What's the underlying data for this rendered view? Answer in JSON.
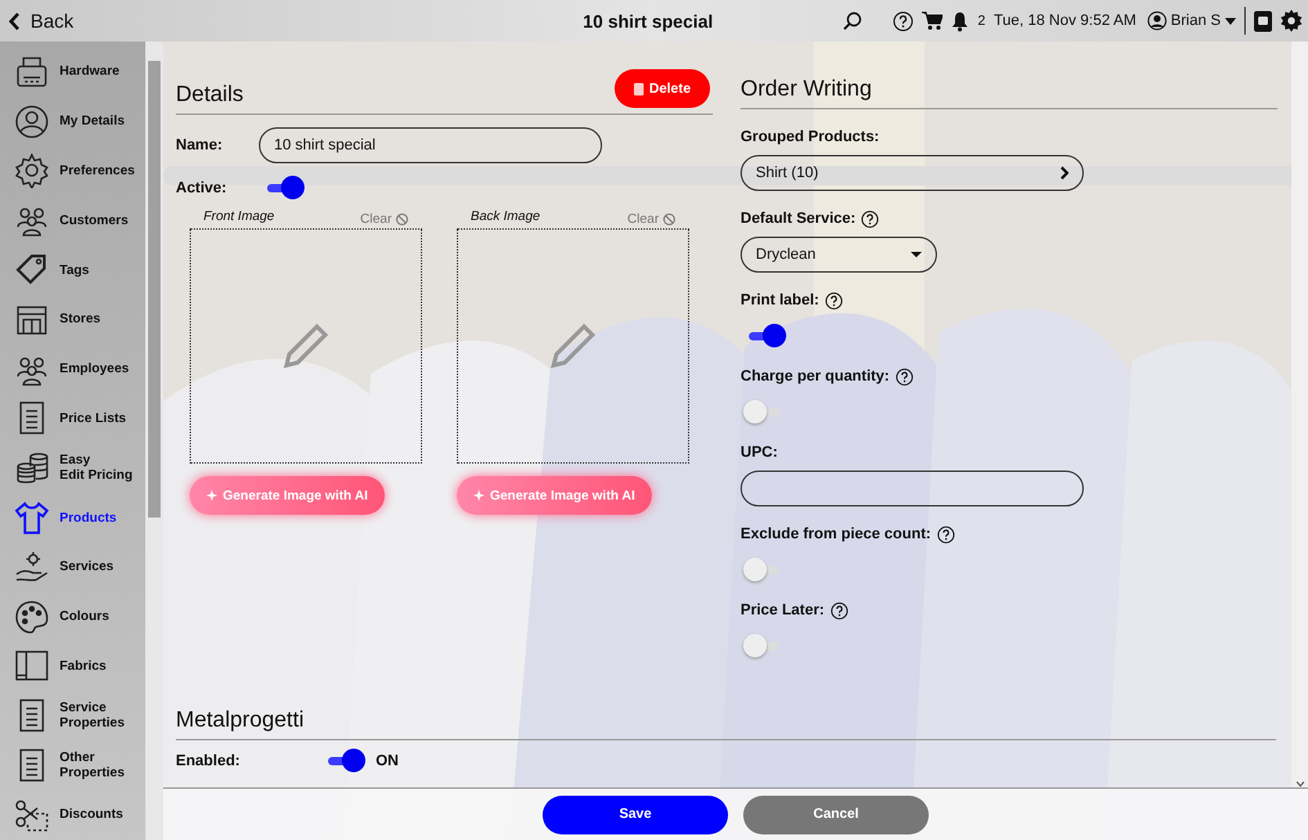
{
  "top_bar": {
    "back": "Back",
    "title": "10 shirt special",
    "notifications": "2",
    "datetime": "Tue, 18 Nov 9:52 AM",
    "user": "Brian S"
  },
  "sidebar": {
    "items": [
      {
        "label": "Hardware",
        "kind": "printer",
        "selected": false
      },
      {
        "label": "My Details",
        "kind": "person",
        "selected": false
      },
      {
        "label": "Preferences",
        "kind": "gear",
        "selected": false
      },
      {
        "label": "Customers",
        "kind": "group",
        "selected": false
      },
      {
        "label": "Tags",
        "kind": "tag",
        "selected": false
      },
      {
        "label": "Stores",
        "kind": "store",
        "selected": false
      },
      {
        "label": "Employees",
        "kind": "group",
        "selected": false
      },
      {
        "label": "Price Lists",
        "kind": "list",
        "selected": false
      },
      {
        "label": "Easy\nEdit Pricing",
        "kind": "coins",
        "selected": false
      },
      {
        "label": "Products",
        "kind": "shirt",
        "selected": true
      },
      {
        "label": "Services",
        "kind": "hand",
        "selected": false
      },
      {
        "label": "Colours",
        "kind": "palette",
        "selected": false
      },
      {
        "label": "Fabrics",
        "kind": "book",
        "selected": false
      },
      {
        "label": "Service\nProperties",
        "kind": "list",
        "selected": false
      },
      {
        "label": "Other\nProperties",
        "kind": "list",
        "selected": false
      },
      {
        "label": "Discounts",
        "kind": "scissors",
        "selected": false
      }
    ]
  },
  "details": {
    "title": "Details",
    "delete": "Delete",
    "name_label": "Name:",
    "name_value": "10 shirt special",
    "active_label": "Active:",
    "active": true,
    "images": [
      {
        "label": "Front Image",
        "clear": "Clear",
        "generate": "Generate Image with AI"
      },
      {
        "label": "Back Image",
        "clear": "Clear",
        "generate": "Generate Image with AI"
      }
    ]
  },
  "order_writing": {
    "title": "Order Writing",
    "fields": [
      {
        "kind": "link",
        "label": "Grouped Products:",
        "help": false,
        "value": "Shirt (10)"
      },
      {
        "kind": "dropdown",
        "label": "Default Service:",
        "help": true,
        "value": "Dryclean"
      },
      {
        "kind": "toggle",
        "label": "Print label:",
        "help": true,
        "on": true
      },
      {
        "kind": "toggle",
        "label": "Charge per quantity:",
        "help": true,
        "on": false
      },
      {
        "kind": "text",
        "label": "UPC:",
        "help": false
      },
      {
        "kind": "toggle",
        "label": "Exclude from piece count:",
        "help": true,
        "on": false
      },
      {
        "kind": "toggle",
        "label": "Price Later:",
        "help": true,
        "on": false
      }
    ]
  },
  "metalprogetti": {
    "title": "Metalprogetti",
    "enabled_label": "Enabled:",
    "enabled": true,
    "enabled_text": "ON"
  },
  "footer": {
    "save": "Save",
    "cancel": "Cancel"
  }
}
